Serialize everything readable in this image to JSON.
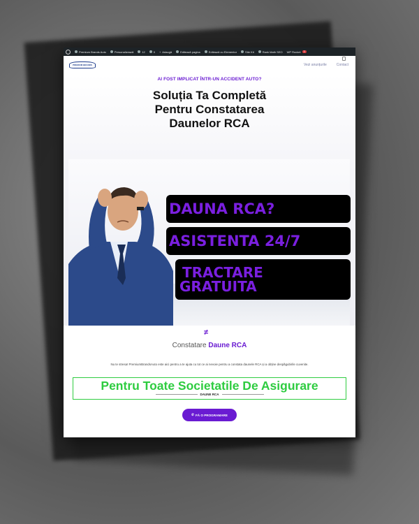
{
  "adminbar": {
    "items": [
      "Premium Brands Auto",
      "Personalizează",
      "12",
      "0",
      "Adaugă",
      "Editează pagina",
      "Editează cu Elementor",
      "Site Kit",
      "Rank Math SEO",
      "WP Rocket"
    ],
    "badge": "3"
  },
  "header": {
    "logo_text": "PREMIUM BRANDS",
    "nav": [
      "Vezi anunțurile",
      "Contact"
    ]
  },
  "hero": {
    "eyebrow": "AI FOST IMPLICAT ÎNTR-UN ACCIDENT AUTO?",
    "headline_1": "Soluția Ta Completă",
    "headline_2": "Pentru Constatarea",
    "headline_3": "Daunelor RCA",
    "badges": [
      "DAUNA RCA?",
      "ASISTENTA 24/7",
      "TRACTARE",
      "GRATUITA"
    ]
  },
  "section": {
    "sub_plain": "Constatare ",
    "sub_accent": "Daune RCA",
    "body": "Nu te stresa! PremiumBrandsAuto este aici pentru a te ajuta cu tot ce ai nevoie pentru a constata daunele RCA și a obține despăgubirile cuvenite.",
    "green_title": "Pentru Toate Societatile De Asigurare",
    "green_label": "DAUNE RCA",
    "cta": "FĂ O PROGRAMARE"
  },
  "colors": {
    "accent": "#6a1bd2",
    "green": "#2ecc40",
    "admin_bg": "#1d2327"
  }
}
